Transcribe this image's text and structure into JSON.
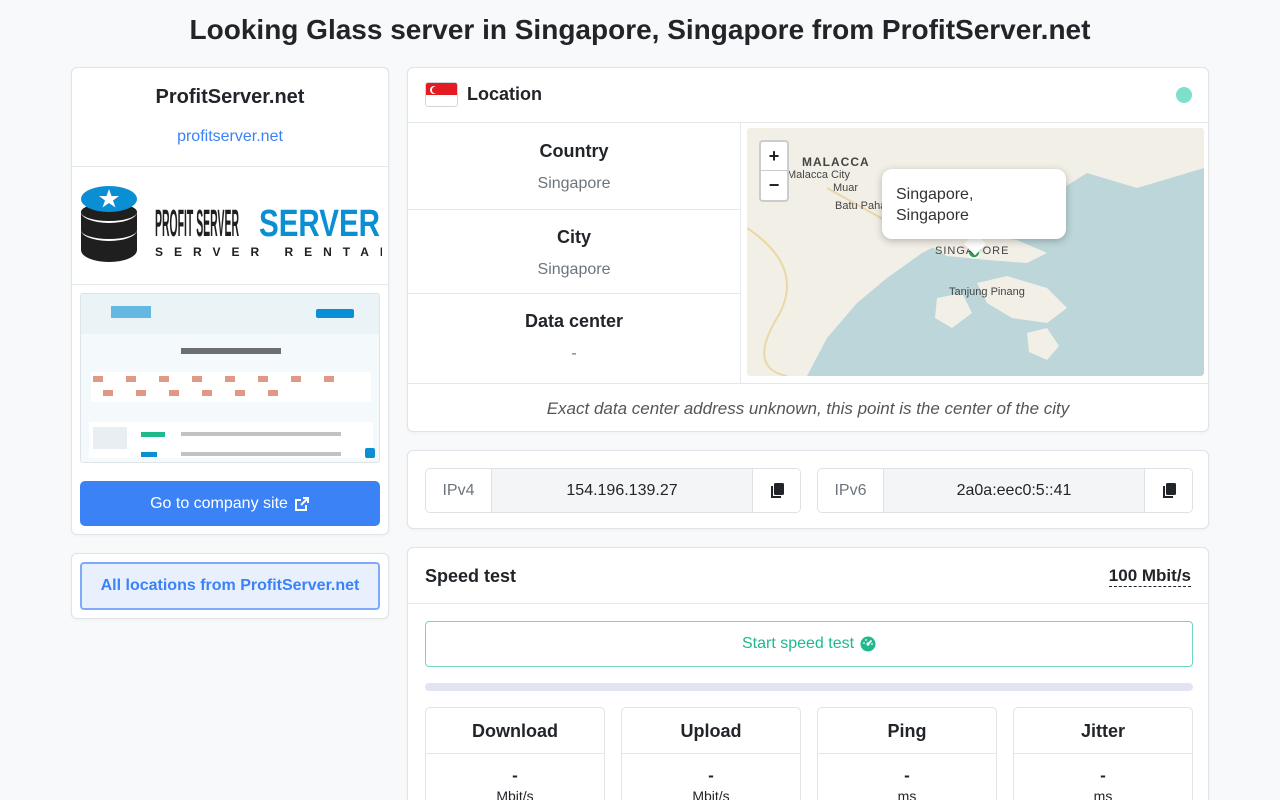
{
  "page_title": "Looking Glass server in Singapore, Singapore from ProfitServer.net",
  "company": {
    "name": "ProfitServer.net",
    "link": "profitserver.net",
    "logo_text": "PROFIT SERVER",
    "logo_subtext": "SERVER RENTAL",
    "go_button": "Go to company site",
    "all_locations_button": "All locations from ProfitServer.net"
  },
  "location": {
    "title": "Location",
    "rows": [
      {
        "label": "Country",
        "value": "Singapore"
      },
      {
        "label": "City",
        "value": "Singapore"
      },
      {
        "label": "Data center",
        "value": "-"
      }
    ],
    "note": "Exact data center address unknown, this point is the center of the city",
    "status_color": "#7ee0c8",
    "map": {
      "zoom_in": "+",
      "zoom_out": "−",
      "popup_line1": "Singapore,",
      "popup_line2": "Singapore",
      "places": [
        "MALACCA",
        "Malacca City",
        "Muar",
        "Batu Pahat",
        "SINGAPORE",
        "Tanjung Pinang"
      ]
    }
  },
  "ip": {
    "v4_label": "IPv4",
    "v4_value": "154.196.139.27",
    "v6_label": "IPv6",
    "v6_value": "2a0a:eec0:5::41"
  },
  "speed": {
    "title": "Speed test",
    "limit": "100 Mbit/s",
    "start_button": "Start speed test",
    "progress": 0,
    "metrics": [
      {
        "label": "Download",
        "value": "-",
        "unit": "Mbit/s"
      },
      {
        "label": "Upload",
        "value": "-",
        "unit": "Mbit/s"
      },
      {
        "label": "Ping",
        "value": "-",
        "unit": "ms"
      },
      {
        "label": "Jitter",
        "value": "-",
        "unit": "ms"
      }
    ]
  },
  "colors": {
    "primary": "#3b82f6",
    "success": "#1fb98e"
  }
}
